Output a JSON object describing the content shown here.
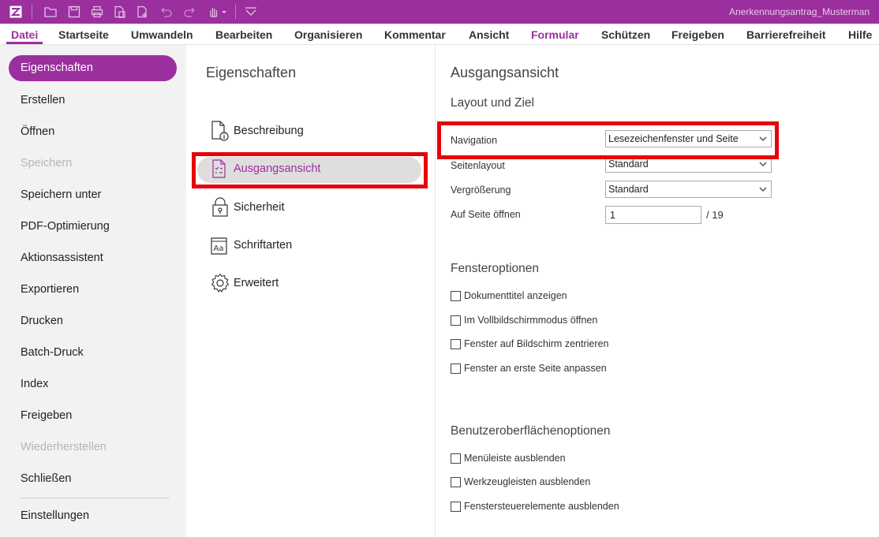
{
  "titlebar": {
    "document_title": "Anerkennungsantrag_Musterman",
    "icons": [
      "app-logo-icon",
      "open-folder-icon",
      "save-icon",
      "print-icon",
      "copy-file-icon",
      "new-file-icon",
      "undo-icon",
      "redo-icon",
      "hand-tool-icon",
      "customize-toolbar-icon"
    ],
    "color": "#9b2f9e"
  },
  "menubar": {
    "items": [
      "Datei",
      "Startseite",
      "Umwandeln",
      "Bearbeiten",
      "Organisieren",
      "Kommentar",
      "Ansicht",
      "Formular",
      "Schützen",
      "Freigeben",
      "Barrierefreiheit",
      "Hilfe"
    ],
    "active": "Datei"
  },
  "left_nav": {
    "active_label": "Eigenschaften",
    "items": [
      "Erstellen",
      "Öffnen",
      "Speichern",
      "Speichern unter",
      "PDF-Optimierung",
      "Aktionsassistent",
      "Exportieren",
      "Drucken",
      "Batch-Druck",
      "Index",
      "Freigeben",
      "Wiederherstellen",
      "Schließen"
    ],
    "disabled": [
      "Speichern",
      "Wiederherstellen"
    ],
    "footer": "Einstellungen"
  },
  "middle": {
    "title": "Eigenschaften",
    "items": [
      {
        "label": "Beschreibung",
        "icon": "document-info-icon"
      },
      {
        "label": "Ausgangsansicht",
        "icon": "document-list-icon"
      },
      {
        "label": "Sicherheit",
        "icon": "lock-icon"
      },
      {
        "label": "Schriftarten",
        "icon": "font-icon"
      },
      {
        "label": "Erweitert",
        "icon": "gear-icon"
      }
    ],
    "selected": "Ausgangsansicht"
  },
  "right": {
    "title": "Ausgangsansicht",
    "layout_heading": "Layout und Ziel",
    "fields": {
      "navigation_label": "Navigation",
      "navigation_value": "Lesezeichenfenster und Seite",
      "layout_label": "Seitenlayout",
      "layout_value": "Standard",
      "zoom_label": "Vergrößerung",
      "zoom_value": "Standard",
      "open_page_label": "Auf Seite öffnen",
      "open_page_value": "1",
      "page_total": "/  19"
    },
    "window_heading": "Fensteroptionen",
    "window_options": [
      {
        "label": "Dokumenttitel anzeigen",
        "checked": false
      },
      {
        "label": "Im Vollbildschirmmodus öffnen",
        "checked": false
      },
      {
        "label": "Fenster auf Bildschirm zentrieren",
        "checked": false
      },
      {
        "label": "Fenster an erste Seite anpassen",
        "checked": false
      }
    ],
    "ui_heading": "Benutzeroberflächenoptionen",
    "ui_options": [
      {
        "label": "Menüleiste ausblenden",
        "checked": false
      },
      {
        "label": "Werkzeugleisten ausblenden",
        "checked": false
      },
      {
        "label": "Fenstersteuerelemente ausblenden",
        "checked": false
      }
    ]
  },
  "colors": {
    "accent": "#9b2f9e",
    "highlight_box": "#e8000b",
    "left_panel_bg": "#f2f2f2"
  }
}
